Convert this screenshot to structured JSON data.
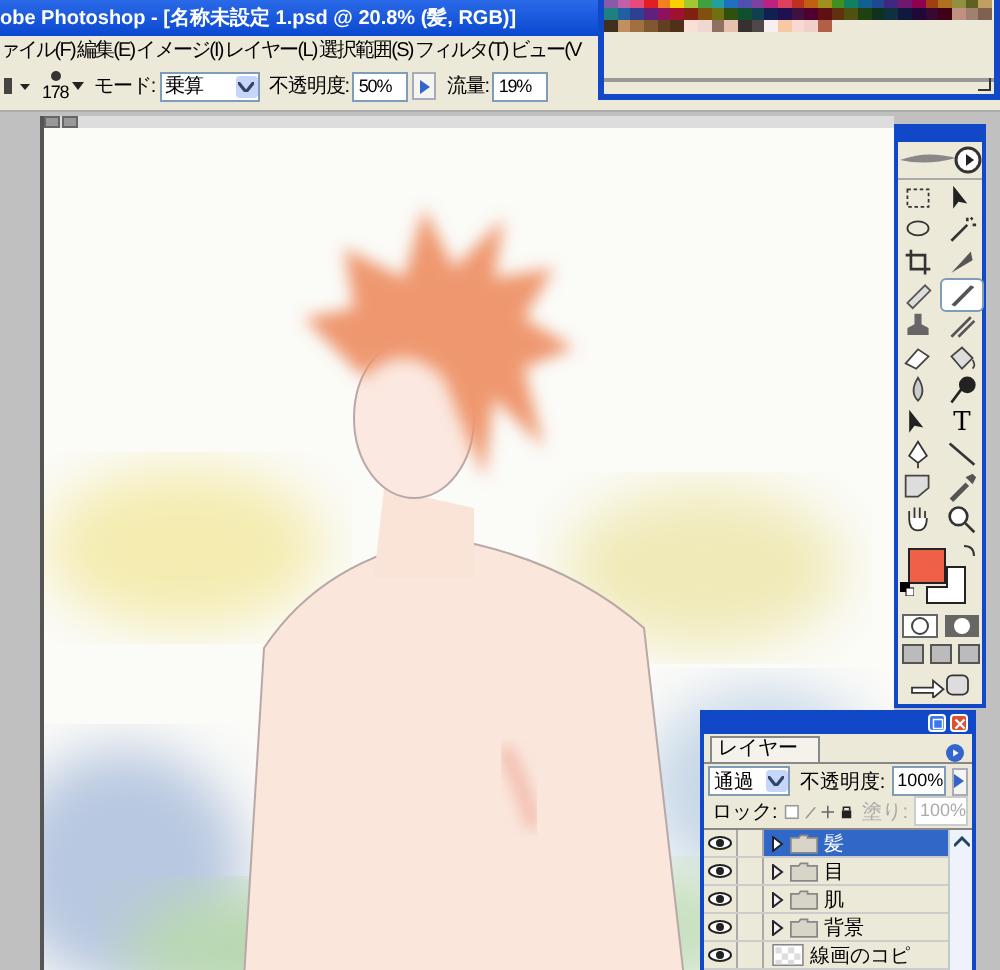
{
  "window": {
    "title": "obe Photoshop - [名称未設定 1.psd @ 20.8% (髪, RGB)]"
  },
  "menu": [
    "ァイル(F)",
    "編集(E)",
    "イメージ(I)",
    "レイヤー(L)",
    "選択範囲(S)",
    "フィルタ(T)",
    "ビュー(V"
  ],
  "options_bar": {
    "brush_size": "178",
    "mode_label": "モード:",
    "mode": "乗算",
    "opacity_label": "不透明度:",
    "opacity": "50%",
    "flow_label": "流量:",
    "flow": "19%"
  },
  "swatches": [
    [
      {
        "color": "#8a5aa8"
      },
      {
        "color": "#c060a8"
      },
      {
        "color": "#e84a7a"
      },
      {
        "color": "#e02020"
      },
      {
        "color": "#f08020"
      },
      {
        "color": "#f8d000"
      },
      {
        "color": "#a0c830"
      },
      {
        "color": "#40a040"
      },
      {
        "color": "#20a0a0"
      },
      {
        "color": "#2070c0"
      },
      {
        "color": "#5050b0"
      },
      {
        "color": "#8040a0"
      },
      {
        "color": "#c02080"
      },
      {
        "color": "#e04060"
      },
      {
        "color": "#c03020"
      },
      {
        "color": "#c06010"
      },
      {
        "color": "#a09020"
      },
      {
        "color": "#409020"
      },
      {
        "color": "#108060"
      },
      {
        "color": "#106090"
      },
      {
        "color": "#204890"
      },
      {
        "color": "#402880"
      },
      {
        "color": "#701870"
      },
      {
        "color": "#900050"
      },
      {
        "color": "#a04010"
      },
      {
        "color": "#b07020"
      },
      {
        "color": "#909040"
      },
      {
        "color": "#606020"
      },
      {
        "color": "#c0a060"
      }
    ],
    [
      {
        "color": "#208080"
      },
      {
        "color": "#2060a0"
      },
      {
        "color": "#304090"
      },
      {
        "color": "#602080"
      },
      {
        "color": "#901060"
      },
      {
        "color": "#a01030"
      },
      {
        "color": "#802010"
      },
      {
        "color": "#805010"
      },
      {
        "color": "#707010"
      },
      {
        "color": "#305010"
      },
      {
        "color": "#105030"
      },
      {
        "color": "#104050"
      },
      {
        "color": "#102050"
      },
      {
        "color": "#201050"
      },
      {
        "color": "#401040"
      },
      {
        "color": "#500030"
      },
      {
        "color": "#601010"
      },
      {
        "color": "#603010"
      },
      {
        "color": "#505010"
      },
      {
        "color": "#204010"
      },
      {
        "color": "#103020"
      },
      {
        "color": "#103040"
      },
      {
        "color": "#101840"
      },
      {
        "color": "#200838"
      },
      {
        "color": "#380830"
      },
      {
        "color": "#400018"
      },
      {
        "color": "#c09080"
      },
      {
        "color": "#a08070"
      },
      {
        "color": "#806050"
      }
    ],
    [
      {
        "color": "#403020"
      },
      {
        "color": "#c09060"
      },
      {
        "color": "#a07040"
      },
      {
        "color": "#805830"
      },
      {
        "color": "#604020"
      },
      {
        "color": "#503018"
      },
      {
        "color": "#f8e0d8"
      },
      {
        "color": "#f0d8d0"
      },
      {
        "color": "#907060"
      },
      {
        "color": "#e8c0b0"
      },
      {
        "color": "#383030"
      },
      {
        "color": "#504848"
      },
      {
        "color": "#f8f0f0"
      },
      {
        "color": "#f8c8a0"
      },
      {
        "color": "#f8d8d0"
      },
      {
        "color": "#f0d0c8"
      },
      {
        "color": "#b06048"
      }
    ]
  ],
  "toolbox": {
    "tools": [
      {
        "kind": "marquee",
        "selected": false
      },
      {
        "kind": "move",
        "selected": false
      },
      {
        "kind": "lasso",
        "selected": false
      },
      {
        "kind": "wand",
        "selected": false
      },
      {
        "kind": "crop",
        "selected": false
      },
      {
        "kind": "slice",
        "selected": false
      },
      {
        "kind": "healing",
        "selected": false
      },
      {
        "kind": "brush",
        "selected": true
      },
      {
        "kind": "stamp",
        "selected": false
      },
      {
        "kind": "history",
        "selected": false
      },
      {
        "kind": "eraser",
        "selected": false
      },
      {
        "kind": "bucket",
        "selected": false
      },
      {
        "kind": "drop",
        "selected": false
      },
      {
        "kind": "dodge",
        "selected": false
      },
      {
        "kind": "select",
        "selected": false
      },
      {
        "kind": "type",
        "selected": false
      },
      {
        "kind": "pen",
        "selected": false
      },
      {
        "kind": "line",
        "selected": false
      },
      {
        "kind": "notes",
        "selected": false
      },
      {
        "kind": "eyedropper",
        "selected": false
      },
      {
        "kind": "hand",
        "selected": false
      },
      {
        "kind": "zoom",
        "selected": false
      }
    ],
    "foreground": {
      "color": "#ee6048"
    },
    "background": {
      "color": "#ffffff"
    },
    "type_tool_label": "T"
  },
  "layers_panel": {
    "tab": "レイヤー",
    "blend_mode": "通過",
    "opacity_label": "不透明度:",
    "opacity": "100%",
    "lock_label": "ロック:",
    "fill_label": "塗り:",
    "fill": "100%",
    "fill_disabled": true,
    "layers": [
      {
        "name": "髪",
        "kind": "folder",
        "visible": true,
        "selected": true
      },
      {
        "name": "目",
        "kind": "folder",
        "visible": true,
        "selected": false
      },
      {
        "name": "肌",
        "kind": "folder",
        "visible": true,
        "selected": false
      },
      {
        "name": "背景",
        "kind": "folder",
        "visible": true,
        "selected": false
      },
      {
        "name": "線画のコピ",
        "kind": "layer",
        "visible": true,
        "selected": false
      }
    ]
  }
}
